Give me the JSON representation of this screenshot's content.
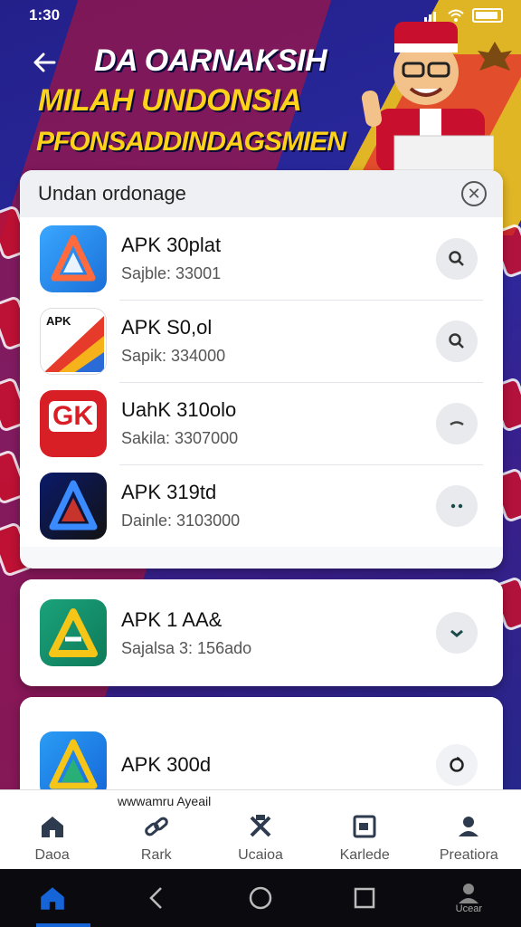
{
  "status": {
    "time": "1:30",
    "icons": [
      "signal-icon",
      "bluetooth-icon",
      "wifi-icon",
      "battery-icon"
    ]
  },
  "header": {
    "line1": "DA OARNAKSIH",
    "line2": "MILAH UNDONSIA",
    "line3": "PFONSADDINDAGSMIEN"
  },
  "panel": {
    "title": "Undan ordonage",
    "items": [
      {
        "name": "APK 30plat",
        "sub": "Sajble: 33001",
        "action_icon": "search-icon"
      },
      {
        "name": "APK S0,ol",
        "sub": "Sapik: 334000",
        "action_icon": "search-icon"
      },
      {
        "name": "UahK 310olo",
        "sub": "Sakila: 3307000",
        "action_icon": "minus-icon"
      },
      {
        "name": "APK 319td",
        "sub": "Dainle: 3103000",
        "action_icon": "dots-icon"
      }
    ]
  },
  "card2": {
    "name": "APK 1 AA&",
    "sub": "Sajalsa 3: 156ado"
  },
  "card3": {
    "name": "APK 300d"
  },
  "icon_labels": {
    "logo2_text": "APK",
    "logo3_text": "GK"
  },
  "ad_text": "wwwamru Ayeail",
  "tabs": [
    {
      "label": "Daoa",
      "icon": "home-icon"
    },
    {
      "label": "Rark",
      "icon": "link-icon"
    },
    {
      "label": "Ucaioa",
      "icon": "tools-icon"
    },
    {
      "label": "Karlede",
      "icon": "calendar-icon"
    },
    {
      "label": "Preatiora",
      "icon": "profile-icon"
    }
  ],
  "sysnav": {
    "extra_label": "Ucear"
  },
  "colors": {
    "accent": "#1565d8",
    "red": "#c8102e",
    "yellow": "#ffd21a",
    "navy": "#23208a"
  }
}
